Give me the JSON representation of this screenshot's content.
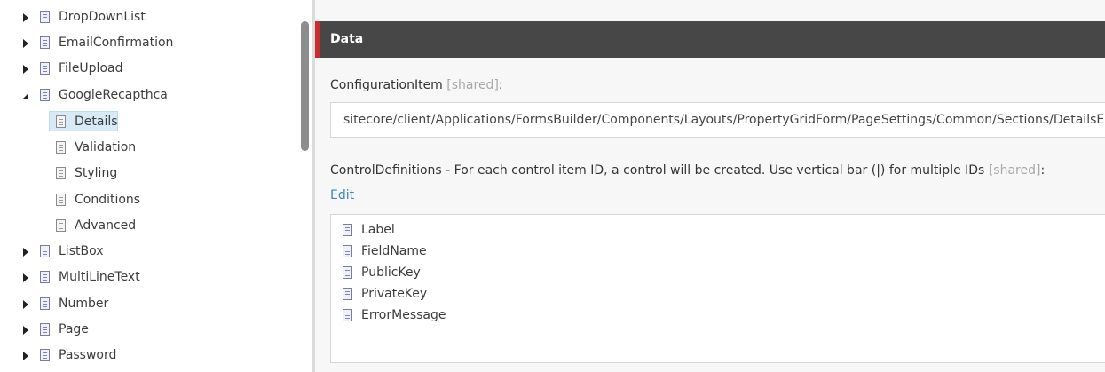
{
  "tree": {
    "nodes": [
      {
        "label": "DropDownList",
        "level": 0,
        "state": "collapsed",
        "icon": "template-icon"
      },
      {
        "label": "EmailConfirmation",
        "level": 0,
        "state": "collapsed",
        "icon": "template-icon"
      },
      {
        "label": "FileUpload",
        "level": 0,
        "state": "collapsed",
        "icon": "template-icon"
      },
      {
        "label": "GoogleRecapthca",
        "level": 0,
        "state": "expanded",
        "icon": "template-icon"
      },
      {
        "label": "Details",
        "level": 1,
        "state": "leaf",
        "icon": "document-icon",
        "selected": true
      },
      {
        "label": "Validation",
        "level": 1,
        "state": "leaf",
        "icon": "document-icon"
      },
      {
        "label": "Styling",
        "level": 1,
        "state": "leaf",
        "icon": "document-icon"
      },
      {
        "label": "Conditions",
        "level": 1,
        "state": "leaf",
        "icon": "document-icon"
      },
      {
        "label": "Advanced",
        "level": 1,
        "state": "leaf",
        "icon": "document-icon"
      },
      {
        "label": "ListBox",
        "level": 0,
        "state": "collapsed",
        "icon": "template-icon"
      },
      {
        "label": "MultiLineText",
        "level": 0,
        "state": "collapsed",
        "icon": "template-icon"
      },
      {
        "label": "Number",
        "level": 0,
        "state": "collapsed",
        "icon": "template-icon"
      },
      {
        "label": "Page",
        "level": 0,
        "state": "collapsed",
        "icon": "template-icon"
      },
      {
        "label": "Password",
        "level": 0,
        "state": "collapsed",
        "icon": "template-icon"
      }
    ]
  },
  "section": {
    "title": "Data",
    "accent_color": "#cc2b2b",
    "header_color": "#474747"
  },
  "fields": {
    "configuration_item": {
      "label": "ConfigurationItem",
      "shared_tag": "[shared]",
      "suffix": ":",
      "value": "sitecore/client/Applications/FormsBuilder/Components/Layouts/PropertyGridForm/PageSettings/Common/Sections/DetailsExpander"
    },
    "control_definitions": {
      "label": "ControlDefinitions - For each control item ID, a control will be created. Use vertical bar (|) for multiple IDs",
      "shared_tag": "[shared]",
      "suffix": ":",
      "edit_label": "Edit",
      "items": [
        "Label",
        "FieldName",
        "PublicKey",
        "PrivateKey",
        "ErrorMessage"
      ]
    }
  },
  "colors": {
    "link": "#3d86b8",
    "selection": "#d7eaf5"
  }
}
